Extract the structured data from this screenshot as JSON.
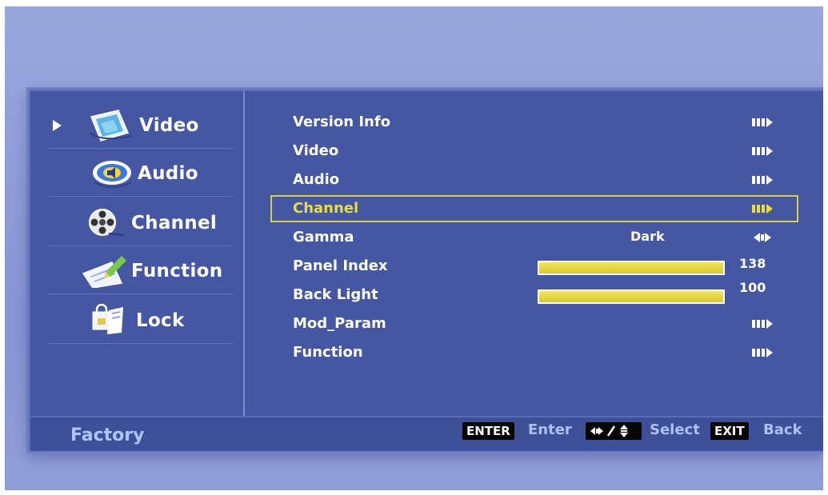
{
  "sidebar": {
    "items": [
      {
        "label": "Video",
        "icon": "video-icon"
      },
      {
        "label": "Audio",
        "icon": "audio-icon"
      },
      {
        "label": "Channel",
        "icon": "channel-icon"
      },
      {
        "label": "Function",
        "icon": "function-icon"
      },
      {
        "label": "Lock",
        "icon": "lock-icon"
      }
    ],
    "active_index": 0
  },
  "menu": {
    "items": [
      {
        "label": "Version Info",
        "type": "submenu"
      },
      {
        "label": "Video",
        "type": "submenu"
      },
      {
        "label": "Audio",
        "type": "submenu"
      },
      {
        "label": "Channel",
        "type": "submenu",
        "selected": true
      },
      {
        "label": "Gamma",
        "type": "option",
        "value": "Dark"
      },
      {
        "label": "Panel Index",
        "type": "slider",
        "value": "138",
        "level": 1.0
      },
      {
        "label": "Back Light",
        "type": "slider",
        "value": "100",
        "level": 1.0
      },
      {
        "label": "Mod_Param",
        "type": "submenu"
      },
      {
        "label": "Function",
        "type": "submenu"
      }
    ]
  },
  "footer": {
    "title": "Factory",
    "enter_key": "ENTER",
    "enter_label": "Enter",
    "select_label": "Select",
    "exit_key": "EXIT",
    "exit_label": "Back"
  },
  "colors": {
    "panel_bg": "#4556a2",
    "highlight": "#e8de3a",
    "footer_text": "#a9c2f0"
  }
}
